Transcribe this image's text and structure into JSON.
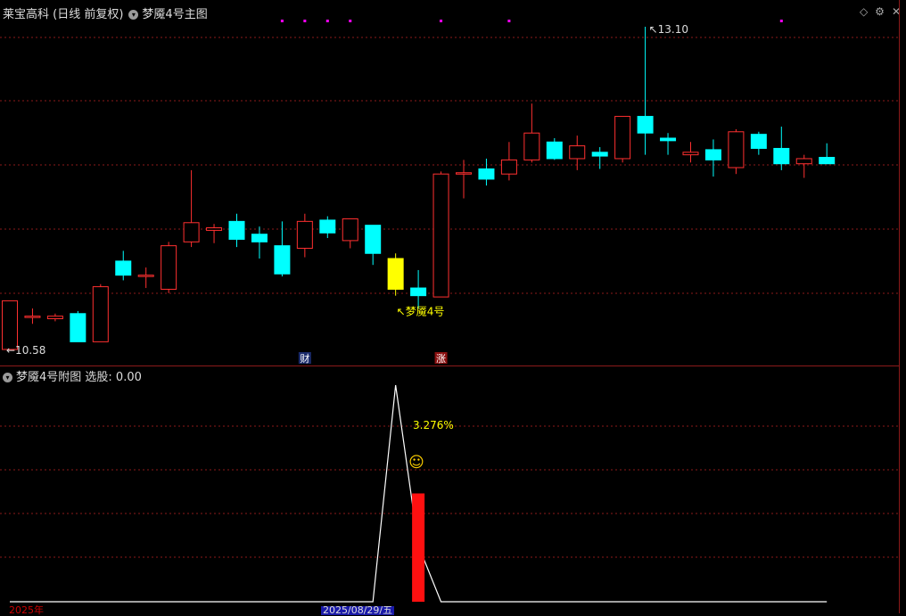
{
  "main_header": {
    "title": "莱宝高科 (日线 前复权)",
    "indicator": "梦魇4号主图"
  },
  "sub_header": {
    "title": "梦魇4号附图",
    "value_text": "选股: 0.00"
  },
  "icons": [
    "diamond-icon",
    "settings-icon",
    "close-icon"
  ],
  "colors": {
    "up": "#ff3030",
    "down": "#00ffff",
    "signal": "#ffff00",
    "dot": "#ff00ff",
    "grid": "#8b1a1a"
  },
  "chart_data": [
    {
      "type": "candlestick",
      "title": "莱宝高科 (日线 前复权)",
      "candles": [
        {
          "o": 10.58,
          "h": 10.96,
          "l": 10.58,
          "c": 10.96
        },
        {
          "o": 10.84,
          "h": 10.9,
          "l": 10.78,
          "c": 10.84
        },
        {
          "o": 10.82,
          "h": 10.86,
          "l": 10.8,
          "c": 10.84
        },
        {
          "o": 10.86,
          "h": 10.88,
          "l": 10.64,
          "c": 10.64
        },
        {
          "o": 10.64,
          "h": 11.09,
          "l": 10.64,
          "c": 11.07
        },
        {
          "o": 11.27,
          "h": 11.35,
          "l": 11.12,
          "c": 11.16
        },
        {
          "o": 11.15,
          "h": 11.22,
          "l": 11.06,
          "c": 11.16
        },
        {
          "o": 11.05,
          "h": 11.42,
          "l": 11.02,
          "c": 11.39
        },
        {
          "o": 11.42,
          "h": 11.98,
          "l": 11.38,
          "c": 11.57
        },
        {
          "o": 11.51,
          "h": 11.56,
          "l": 11.41,
          "c": 11.53
        },
        {
          "o": 11.58,
          "h": 11.64,
          "l": 11.38,
          "c": 11.44
        },
        {
          "o": 11.48,
          "h": 11.54,
          "l": 11.29,
          "c": 11.42
        },
        {
          "o": 11.39,
          "h": 11.58,
          "l": 11.15,
          "c": 11.17
        },
        {
          "o": 11.37,
          "h": 11.64,
          "l": 11.3,
          "c": 11.58
        },
        {
          "o": 11.59,
          "h": 11.62,
          "l": 11.45,
          "c": 11.49
        },
        {
          "o": 11.43,
          "h": 11.6,
          "l": 11.37,
          "c": 11.6
        },
        {
          "o": 11.55,
          "h": 11.55,
          "l": 11.24,
          "c": 11.33
        },
        {
          "o": 11.29,
          "h": 11.33,
          "l": 11.0,
          "c": 11.05
        },
        {
          "o": 11.06,
          "h": 11.2,
          "l": 10.9,
          "c": 11.0
        },
        {
          "o": 10.99,
          "h": 11.97,
          "l": 10.99,
          "c": 11.95
        },
        {
          "o": 11.95,
          "h": 12.06,
          "l": 11.76,
          "c": 11.96
        },
        {
          "o": 11.99,
          "h": 12.07,
          "l": 11.86,
          "c": 11.91
        },
        {
          "o": 11.95,
          "h": 12.2,
          "l": 11.9,
          "c": 12.06
        },
        {
          "o": 12.06,
          "h": 12.5,
          "l": 12.04,
          "c": 12.27
        },
        {
          "o": 12.2,
          "h": 12.23,
          "l": 12.06,
          "c": 12.07
        },
        {
          "o": 12.07,
          "h": 12.25,
          "l": 11.98,
          "c": 12.17
        },
        {
          "o": 12.12,
          "h": 12.16,
          "l": 11.99,
          "c": 12.09
        },
        {
          "o": 12.07,
          "h": 12.29,
          "l": 12.04,
          "c": 12.4
        },
        {
          "o": 12.4,
          "h": 13.1,
          "l": 12.1,
          "c": 12.27
        },
        {
          "o": 12.23,
          "h": 12.27,
          "l": 12.1,
          "c": 12.21
        },
        {
          "o": 12.1,
          "h": 12.2,
          "l": 12.04,
          "c": 12.12
        },
        {
          "o": 12.14,
          "h": 12.22,
          "l": 11.93,
          "c": 12.06
        },
        {
          "o": 12.0,
          "h": 12.3,
          "l": 11.95,
          "c": 12.28
        },
        {
          "o": 12.26,
          "h": 12.28,
          "l": 12.1,
          "c": 12.15
        },
        {
          "o": 12.15,
          "h": 12.32,
          "l": 11.98,
          "c": 12.03
        },
        {
          "o": 12.03,
          "h": 12.1,
          "l": 11.92,
          "c": 12.07
        },
        {
          "o": 12.08,
          "h": 12.19,
          "l": 12.03,
          "c": 12.03
        }
      ],
      "signal_candle_index": 17,
      "dot_candle_indices": [
        12,
        13,
        14,
        15,
        19,
        22,
        34
      ],
      "annotations": {
        "max_label": "13.10",
        "min_label": "10.58",
        "signal_label": "梦魇4号"
      },
      "badges": [
        {
          "label": "财",
          "candle_index": 13
        },
        {
          "label": "涨",
          "candle_index": 19
        }
      ]
    },
    {
      "type": "line",
      "title": "梦魇4号附图",
      "series": [
        {
          "values": [
            0,
            0,
            0,
            0,
            0,
            0,
            0,
            0,
            0,
            0,
            0,
            0,
            0,
            0,
            0,
            0,
            0,
            1,
            0.26,
            0,
            0,
            0,
            0,
            0,
            0,
            0,
            0,
            0,
            0,
            0,
            0,
            0,
            0,
            0,
            0,
            0,
            0
          ]
        }
      ],
      "bar": {
        "candle_index": 18,
        "value": 0.5
      },
      "percent_label": "3.276%",
      "smiley": "☺",
      "bottom_date": "2025/08/29/五",
      "bottom_year": "2025年"
    }
  ]
}
